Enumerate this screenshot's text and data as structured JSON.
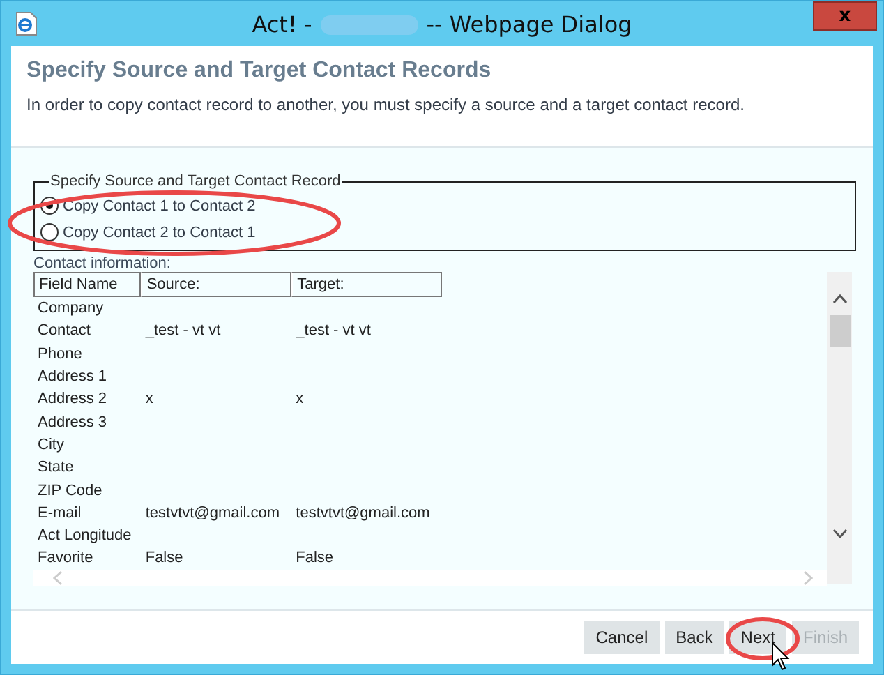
{
  "window": {
    "title_prefix": "Act! -",
    "title_suffix": "-- Webpage Dialog",
    "close_label": "x"
  },
  "header": {
    "title": "Specify Source and Target Contact Records",
    "description": "In order to copy contact record to another, you must specify a source and a target contact record."
  },
  "copy_direction": {
    "legend": "Specify Source and Target Contact Record",
    "options": [
      {
        "label": "Copy Contact 1 to Contact 2",
        "selected": true
      },
      {
        "label": "Copy Contact 2 to Contact 1",
        "selected": false
      }
    ]
  },
  "contact_info": {
    "label": "Contact information:",
    "columns": [
      "Field Name",
      "Source:",
      "Target:"
    ],
    "rows": [
      [
        "Company",
        "",
        ""
      ],
      [
        "Contact",
        "_test - vt vt",
        "_test - vt vt"
      ],
      [
        "Phone",
        "",
        ""
      ],
      [
        "Address 1",
        "",
        ""
      ],
      [
        "Address 2",
        "x",
        "x"
      ],
      [
        "Address 3",
        "",
        ""
      ],
      [
        "City",
        "",
        ""
      ],
      [
        "State",
        "",
        ""
      ],
      [
        "ZIP Code",
        "",
        ""
      ],
      [
        "E-mail",
        "testvtvt@gmail.com",
        "testvtvt@gmail.com"
      ],
      [
        "Act Longitude",
        "",
        ""
      ],
      [
        "Favorite",
        "False",
        "False"
      ]
    ]
  },
  "buttons": [
    {
      "label": "Cancel",
      "disabled": false
    },
    {
      "label": "Back",
      "disabled": false
    },
    {
      "label": "Next",
      "disabled": false
    },
    {
      "label": "Finish",
      "disabled": true
    }
  ]
}
